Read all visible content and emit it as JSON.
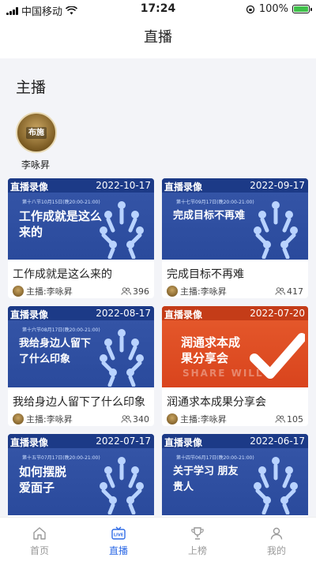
{
  "status_bar": {
    "carrier": "中国移动",
    "time": "17:24",
    "battery": "100%"
  },
  "header": {
    "title": "直播"
  },
  "host_section": {
    "title": "主播",
    "hosts": [
      {
        "name": "李咏昇",
        "avatar_text": "布施"
      }
    ]
  },
  "cards": [
    {
      "badge": "直播录像",
      "date": "2022-10-17",
      "headline": "工作成就是这么来的",
      "sub": "第十八节10月15日(晚20:00-21:00)",
      "title": "工作成就是这么来的",
      "host": "主播:李咏昇",
      "views": "396",
      "theme": "blue"
    },
    {
      "badge": "直播录像",
      "date": "2022-09-17",
      "headline": "完成目标不再难",
      "sub": "第十七节09月17日(晚20:00-21:00)",
      "title": "完成目标不再难",
      "host": "主播:李咏昇",
      "views": "417",
      "theme": "blue"
    },
    {
      "badge": "直播录像",
      "date": "2022-08-17",
      "headline": "我给身边人留下了什么印象",
      "sub": "第十六节08月17日(晚20:00-21:00)",
      "title": "我给身边人留下了什么印象",
      "host": "主播:李咏昇",
      "views": "340",
      "theme": "blue"
    },
    {
      "badge": "直播录像",
      "date": "2022-07-20",
      "headline": "润通求本成果分享会",
      "sub": "",
      "title": "润通求本成果分享会",
      "host": "主播:李咏昇",
      "views": "105",
      "theme": "red",
      "watermark": "SHARE WILL"
    },
    {
      "badge": "直播录像",
      "date": "2022-07-17",
      "headline": "如何摆脱爱面子",
      "sub": "第十五节07月17日(晚20:00-21:00)",
      "title": "",
      "host": "",
      "views": "",
      "theme": "blue"
    },
    {
      "badge": "直播录像",
      "date": "2022-06-17",
      "headline": "关于学习 朋友 贵人",
      "sub": "第十四节06月17日(晚20:00-21:00)",
      "title": "",
      "host": "",
      "views": "",
      "theme": "blue"
    }
  ],
  "tabbar": {
    "items": [
      {
        "label": "首页",
        "icon": "home-icon",
        "active": false
      },
      {
        "label": "直播",
        "icon": "live-tv-icon",
        "active": true
      },
      {
        "label": "上榜",
        "icon": "trophy-icon",
        "active": false
      },
      {
        "label": "我的",
        "icon": "user-icon",
        "active": false
      }
    ]
  },
  "colors": {
    "accent": "#2f6be6",
    "card_blue": "#2a4a9c",
    "card_red": "#e65b2d",
    "background": "#f3f4f8"
  }
}
